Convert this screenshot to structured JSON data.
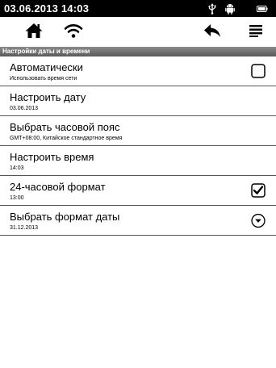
{
  "status_bar": {
    "time": "03.06.2013  14:03",
    "icons": [
      "usb-icon",
      "android-icon",
      "battery-icon"
    ]
  },
  "toolbar": {
    "icons": [
      "home-icon",
      "wifi-icon",
      "back-icon",
      "menu-icon"
    ]
  },
  "section": {
    "title": "Настройки даты и времени"
  },
  "items": [
    {
      "title": "Автоматически",
      "subtitle": "Использовать время сети",
      "control": "checkbox",
      "checked": false
    },
    {
      "title": "Настроить дату",
      "subtitle": "03.06.2013"
    },
    {
      "title": "Выбрать часовой пояс",
      "subtitle": "GMT+08:00, Китайское стандартное время"
    },
    {
      "title": "Настроить время",
      "subtitle": "14:03"
    },
    {
      "title": "24-часовой формат",
      "subtitle": "13:00",
      "control": "checkbox",
      "checked": true
    },
    {
      "title": "Выбрать формат даты",
      "subtitle": "31.12.2013",
      "control": "dropdown"
    }
  ]
}
